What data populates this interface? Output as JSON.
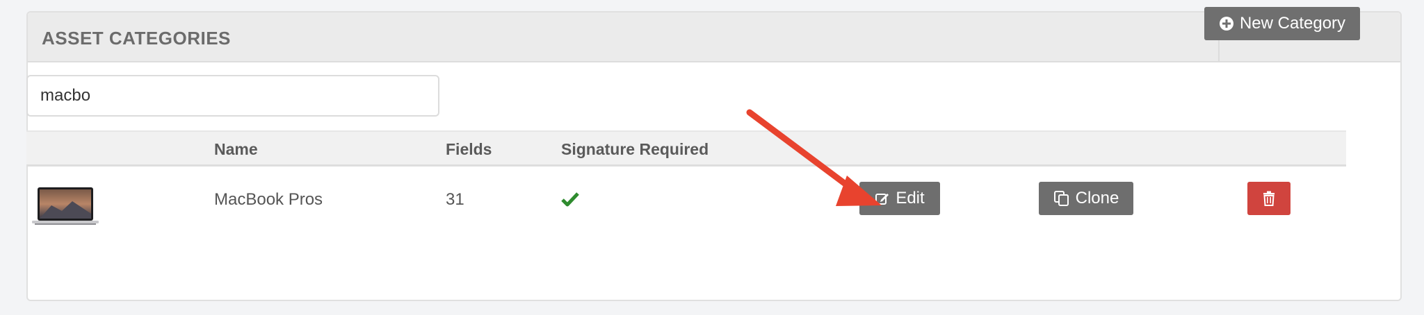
{
  "panel": {
    "title": "ASSET CATEGORIES",
    "new_button_label": "New Category"
  },
  "search": {
    "value": "macbo"
  },
  "table": {
    "columns": [
      "Name",
      "Fields",
      "Signature Required"
    ],
    "rows": [
      {
        "name": "MacBook Pros",
        "fields": "31",
        "signature_required": true,
        "thumbnail": "laptop-thumbnail"
      }
    ],
    "actions": {
      "edit_label": "Edit",
      "clone_label": "Clone",
      "delete_icon": "trash-icon"
    }
  },
  "colors": {
    "button_gray": "#6e6e6e",
    "delete_red": "#d0443e",
    "check_green": "#2e8b2e",
    "annotation_arrow": "#e8432e"
  }
}
